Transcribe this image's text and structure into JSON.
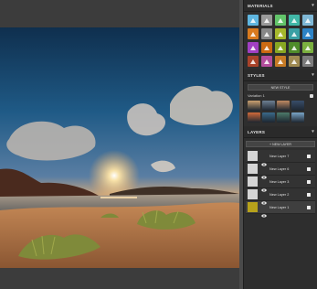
{
  "panel": {
    "materials_title": "MATERIALS",
    "styles_title": "STYLES",
    "layers_title": "LAYERS",
    "new_style_label": "NEW STYLE",
    "variation_label": "Variation 1",
    "add_layer_label": "+ NEW LAYER",
    "materials": [
      {
        "color": "#5fb6e0",
        "icon": "tree-icon"
      },
      {
        "color": "#9a9a9a",
        "icon": "bank-icon"
      },
      {
        "color": "#62c46a",
        "icon": "mountain-icon"
      },
      {
        "color": "#41b7a7",
        "icon": "grass-icon"
      },
      {
        "color": "#7fb8d6",
        "icon": "crop-icon"
      },
      {
        "color": "#d97a1e",
        "icon": "fire-icon"
      },
      {
        "color": "#888888",
        "icon": "hut-icon"
      },
      {
        "color": "#a6b82c",
        "icon": "pyramid-icon"
      },
      {
        "color": "#3aa0a4",
        "icon": "wave-icon"
      },
      {
        "color": "#2d83c6",
        "icon": "water-icon"
      },
      {
        "color": "#a13fc3",
        "icon": "flower-icon"
      },
      {
        "color": "#cc6a12",
        "icon": "sun-icon"
      },
      {
        "color": "#88a722",
        "icon": "hill-icon"
      },
      {
        "color": "#4f8c2a",
        "icon": "field-icon"
      },
      {
        "color": "#7bb03f",
        "icon": "shrub-icon"
      },
      {
        "color": "#a9432a",
        "icon": "rock-icon"
      },
      {
        "color": "#b44d9c",
        "icon": "tree-icon"
      },
      {
        "color": "#c77b25",
        "icon": "cactus-icon"
      },
      {
        "color": "#9f8a52",
        "icon": "sand-icon"
      },
      {
        "color": "#7c7c7c",
        "icon": "house-icon"
      }
    ],
    "style_thumbs": [
      {
        "color": "#caa070"
      },
      {
        "color": "#6d7f93"
      },
      {
        "color": "#c08a62"
      },
      {
        "color": "#384d6a"
      },
      {
        "color": "#d16a3a"
      },
      {
        "color": "#3a6a8a"
      },
      {
        "color": "#4d7a6a"
      },
      {
        "color": "#7aa5c8"
      }
    ],
    "layers": [
      {
        "name": "New Layer 7",
        "active": false
      },
      {
        "name": "New Layer 6",
        "active": false
      },
      {
        "name": "New Layer 3",
        "active": false
      },
      {
        "name": "New Layer 2",
        "active": false
      },
      {
        "name": "New Layer 1",
        "active": true
      }
    ]
  }
}
